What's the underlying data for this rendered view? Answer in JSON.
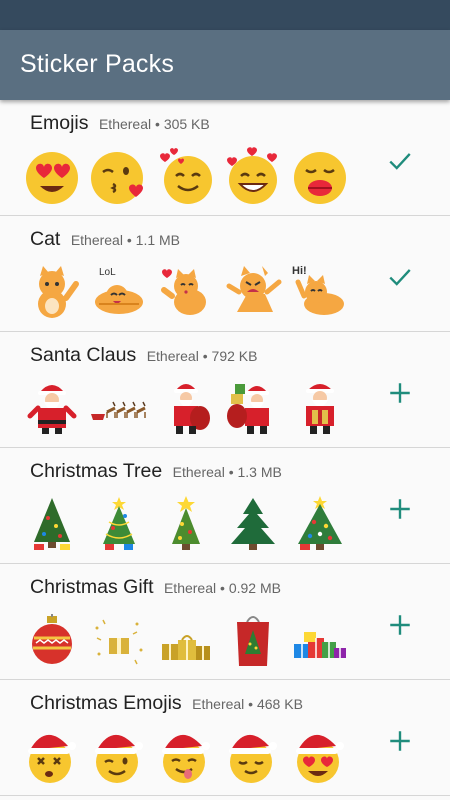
{
  "app": {
    "title": "Sticker Packs"
  },
  "colors": {
    "accent": "#1f8c7c",
    "appbar": "#5a6f81",
    "statusbar": "#354a5e"
  },
  "packs": [
    {
      "name": "Emojis",
      "publisher": "Ethereal",
      "size": "305 KB",
      "added": true,
      "stickers": [
        "heart-eyes-emoji",
        "kiss-wink-emoji",
        "hearts-smile-emoji",
        "grin-hearts-emoji",
        "kiss-lips-emoji"
      ]
    },
    {
      "name": "Cat",
      "publisher": "Ethereal",
      "size": "1.1 MB",
      "added": true,
      "stickers": [
        "cat-waving",
        "cat-lol",
        "cat-blowing-kiss",
        "cat-angry",
        "cat-hi"
      ]
    },
    {
      "name": "Santa Claus",
      "publisher": "Ethereal",
      "size": "792 KB",
      "added": false,
      "stickers": [
        "santa-standing",
        "santa-sleigh-reindeer",
        "santa-with-sack",
        "santa-with-gifts",
        "santa-holding-gift"
      ]
    },
    {
      "name": "Christmas Tree",
      "publisher": "Ethereal",
      "size": "1.3 MB",
      "added": false,
      "stickers": [
        "christmas-tree-decorated",
        "christmas-tree-lights",
        "christmas-tree-star",
        "christmas-tree-pine",
        "christmas-tree-ornaments"
      ]
    },
    {
      "name": "Christmas Gift",
      "publisher": "Ethereal",
      "size": "0.92 MB",
      "added": false,
      "stickers": [
        "christmas-ornament-ball",
        "gift-sparkles",
        "gold-gifts",
        "red-gift-bag",
        "colorful-gift-pile"
      ]
    },
    {
      "name": "Christmas Emojis",
      "publisher": "Ethereal",
      "size": "468 KB",
      "added": false,
      "stickers": [
        "santa-hat-dizzy-emoji",
        "santa-hat-wink-emoji",
        "santa-hat-tongue-emoji",
        "santa-hat-relieved-emoji",
        "santa-hat-heart-eyes-emoji"
      ]
    }
  ]
}
